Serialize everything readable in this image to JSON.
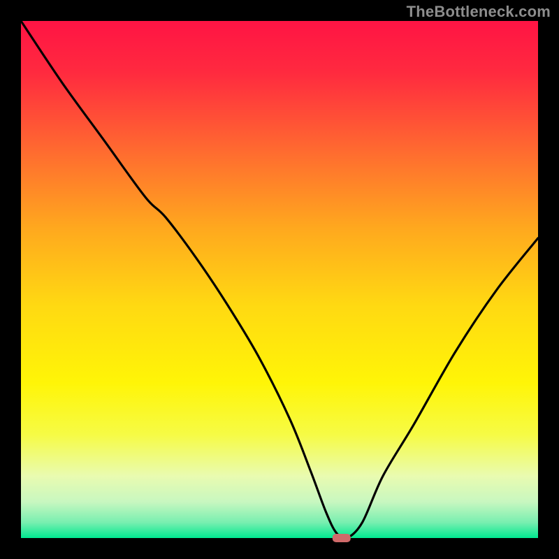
{
  "watermark": "TheBottleneck.com",
  "chart_data": {
    "type": "line",
    "xlim": [
      0,
      100
    ],
    "ylim": [
      0,
      100
    ],
    "title": "",
    "xlabel": "",
    "ylabel": "",
    "grid": false,
    "legend": false,
    "series": [
      {
        "name": "bottleneck-curve",
        "x": [
          0,
          8,
          16,
          24,
          28,
          34,
          40,
          46,
          52,
          56,
          59,
          61,
          63,
          66,
          70,
          76,
          84,
          92,
          100
        ],
        "y": [
          100,
          88,
          77,
          66,
          62,
          54,
          45,
          35,
          23,
          13,
          5,
          1,
          0,
          3,
          12,
          22,
          36,
          48,
          58
        ]
      }
    ],
    "marker": {
      "x": 62,
      "y": 0
    },
    "gradient_stops": [
      {
        "offset": 0.0,
        "color": "#ff1444"
      },
      {
        "offset": 0.1,
        "color": "#ff2a3f"
      },
      {
        "offset": 0.25,
        "color": "#ff6a30"
      },
      {
        "offset": 0.4,
        "color": "#ffa81e"
      },
      {
        "offset": 0.55,
        "color": "#ffd912"
      },
      {
        "offset": 0.7,
        "color": "#fff507"
      },
      {
        "offset": 0.8,
        "color": "#f6fb45"
      },
      {
        "offset": 0.88,
        "color": "#e9fbb0"
      },
      {
        "offset": 0.93,
        "color": "#c8f7c0"
      },
      {
        "offset": 0.97,
        "color": "#78efb0"
      },
      {
        "offset": 1.0,
        "color": "#00e890"
      }
    ],
    "border_px": 30
  }
}
